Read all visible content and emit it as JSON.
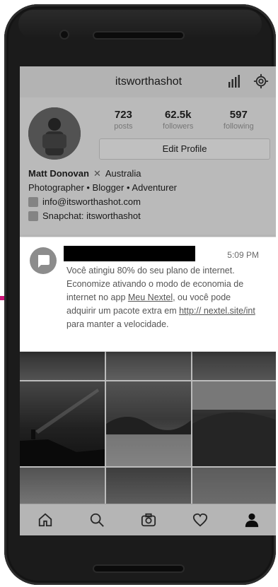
{
  "app": {
    "title": "itsworthashot",
    "stats": [
      {
        "value": "723",
        "label": "posts"
      },
      {
        "value": "62.5k",
        "label": "followers"
      },
      {
        "value": "597",
        "label": "following"
      }
    ],
    "edit_profile_label": "Edit Profile",
    "bio": {
      "name": "Matt Donovan",
      "location": "Australia",
      "tagline": "Photographer • Blogger • Adventurer",
      "email": "info@itsworthashot.com",
      "snapchat": "Snapchat: itsworthashot"
    }
  },
  "notification": {
    "time": "5:09 PM",
    "body_part1": "Você atingiu 80% do seu plano de internet. Economize ativando o modo de economia de internet no app ",
    "link1": "Meu Nextel,",
    "body_part2": " ou você pode adquirir um pacote extra em ",
    "link2": "http:// nextel.site/int",
    "body_part3": " para manter a velocidade."
  },
  "icons": {
    "stats": "bar-chart-icon",
    "settings": "gear-icon",
    "message": "message-icon",
    "nav": [
      "home-icon",
      "search-icon",
      "camera-icon",
      "heart-icon",
      "profile-icon"
    ]
  },
  "colors": {
    "phone_body": "#1b1b1b",
    "notification_bg": "#ffffff",
    "pointer": "#d0147a"
  }
}
